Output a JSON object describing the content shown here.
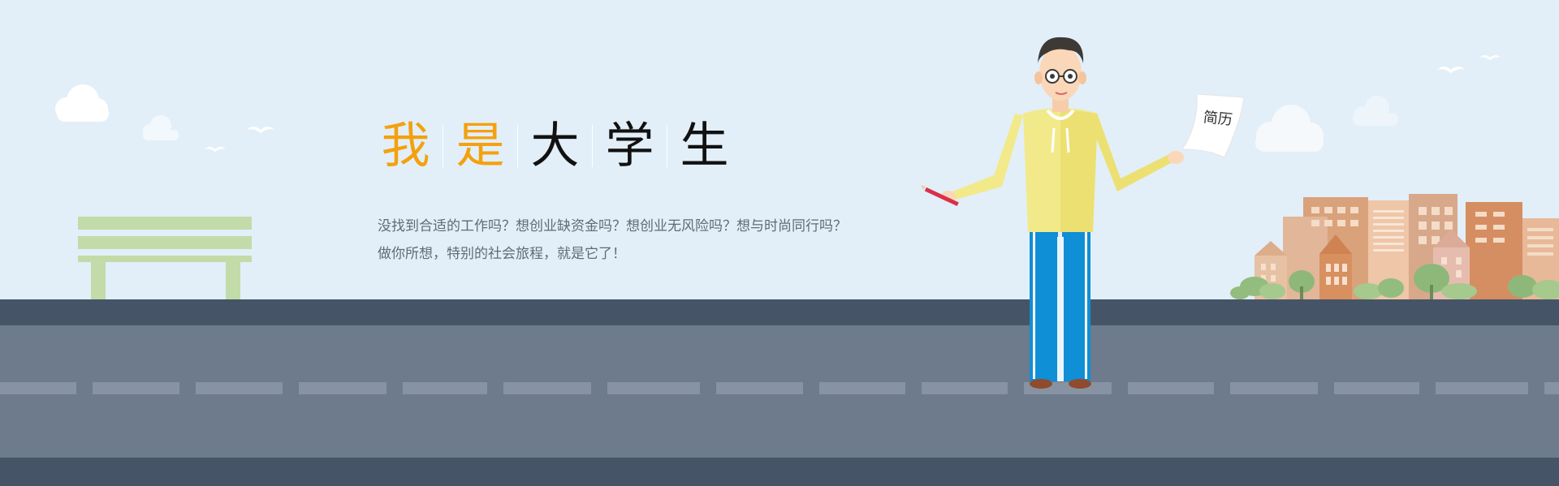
{
  "hero": {
    "title_chars": [
      {
        "text": "我",
        "color": "#f4a10f"
      },
      {
        "text": "是",
        "color": "#f4a10f"
      },
      {
        "text": "大",
        "color": "#111111"
      },
      {
        "text": "学",
        "color": "#111111"
      },
      {
        "text": "生",
        "color": "#111111"
      }
    ],
    "description_lines": [
      "没找到合适的工作吗？想创业缺资金吗？想创业无风险吗？想与时尚同行吗？",
      "做你所想，特别的社会旅程，就是它了！"
    ]
  },
  "character": {
    "paper_text": "简历"
  },
  "colors": {
    "sky": "#e2eff8",
    "ground_dark": "#455567",
    "road": "#6d7b8d",
    "lane": "#8793a2",
    "accent": "#f4a10f",
    "shirt": "#f2ea8a",
    "pants": "#0f8fd6",
    "bench": "#c3dba8",
    "building": "#d9a27a"
  },
  "icons": [
    "cloud-icon",
    "bird-icon",
    "bench-icon",
    "student-figure",
    "resume-paper-icon",
    "pencil-icon",
    "city-skyline-icon",
    "tree-icon"
  ]
}
